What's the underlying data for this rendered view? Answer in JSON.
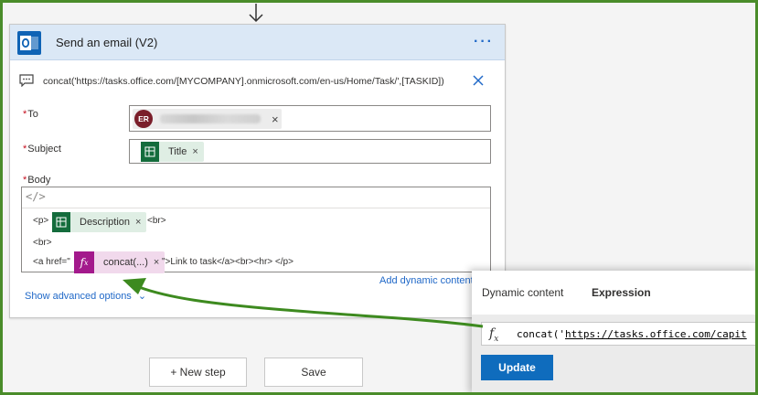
{
  "card": {
    "title": "Send an email (V2)",
    "more": "···",
    "comment": "concat('https://tasks.office.com/[MYCOMPANY].onmicrosoft.com/en-us/Home/Task/',[TASKID])"
  },
  "fields": {
    "to_label": "To",
    "subject_label": "Subject",
    "body_label": "Body",
    "required_mark": "*",
    "to_avatar_initials": "ER",
    "subject_token": "Title",
    "token_remove": "×"
  },
  "body_editor": {
    "code_toggle": "</>",
    "line1_prefix": "<p>",
    "line1_token": "Description",
    "line1_suffix": "<br>",
    "line2": "<br>",
    "line3_prefix": "<a href=\"",
    "line3_token": "concat(...)",
    "line3_suffix": "\">Link to task</a><br><hr> </p>"
  },
  "links": {
    "add_dynamic": "Add dynamic content",
    "show_advanced": "Show advanced options",
    "chevron": "⌄"
  },
  "buttons": {
    "new_step": "+ New step",
    "save": "Save"
  },
  "expression_panel": {
    "tab_dynamic": "Dynamic content",
    "tab_expression": "Expression",
    "fx": "fx",
    "expr_prefix": "concat('",
    "expr_link": "https://tasks.office.com/capit",
    "update": "Update"
  },
  "colors": {
    "header_bg": "#dbe8f6",
    "link": "#2169c8",
    "sharepoint_token": "#146c3c",
    "expression_token": "#a3198c",
    "update_button": "#0f6cbd",
    "annotation_arrow": "#3d8a1f"
  }
}
